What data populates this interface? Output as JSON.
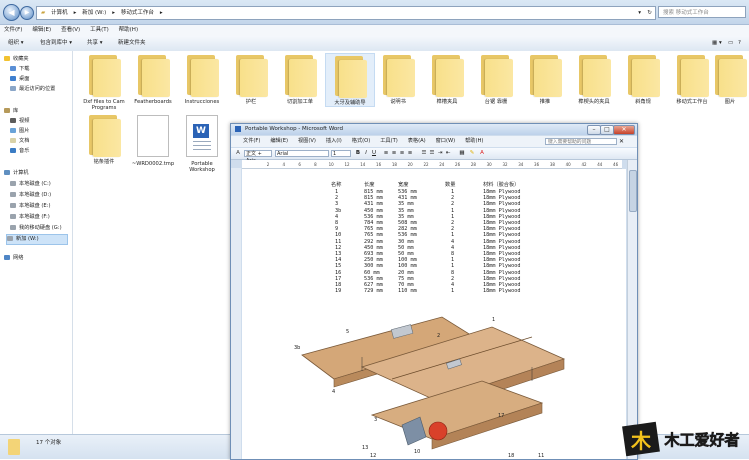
{
  "address": {
    "crumbs": [
      "计算机",
      "新加 (W:)",
      "移动式工作台"
    ],
    "search_placeholder": "搜索 移动式工作台"
  },
  "menu": [
    "文件(F)",
    "编辑(E)",
    "查看(V)",
    "工具(T)",
    "帮助(H)"
  ],
  "toolbar": {
    "organize": "组织 ▾",
    "include": "包含到库中 ▾",
    "share": "共享 ▾",
    "new_folder": "新建文件夹"
  },
  "nav": {
    "favorites": "收藏夹",
    "fav_items": [
      "下载",
      "桌面",
      "最近访问的位置"
    ],
    "libraries": "库",
    "lib_items": [
      "视频",
      "图片",
      "文档",
      "音乐"
    ],
    "computer": "计算机",
    "drives": [
      "本地磁盘 (C:)",
      "本地磁盘 (D:)",
      "本地磁盘 (E:)",
      "本地磁盘 (F:)",
      "我的移动硬盘 (G:)",
      "新加 (W:)"
    ],
    "network": "网络"
  },
  "items": [
    {
      "label": "Dxf files to Cam Programs",
      "kind": "folder"
    },
    {
      "label": "Featherboards",
      "kind": "folder"
    },
    {
      "label": "Instrucciones",
      "kind": "folder"
    },
    {
      "label": "护栏",
      "kind": "folder"
    },
    {
      "label": "切割加工单",
      "kind": "folder"
    },
    {
      "label": "大牙及辅助导",
      "kind": "folder"
    },
    {
      "label": "说明书",
      "kind": "folder"
    },
    {
      "label": "榫槽夹具",
      "kind": "folder"
    },
    {
      "label": "台锯 靠栅",
      "kind": "folder"
    },
    {
      "label": "推推",
      "kind": "folder"
    },
    {
      "label": "榫楔头的夹具",
      "kind": "folder"
    },
    {
      "label": "斜角规",
      "kind": "folder"
    },
    {
      "label": "移动式工作台",
      "kind": "folder"
    },
    {
      "label": "图片",
      "kind": "folder"
    },
    {
      "label": "铭条插件",
      "kind": "folder"
    },
    {
      "label": "~WRD0002.tmp",
      "kind": "file"
    },
    {
      "label": "Portable Workshop",
      "kind": "doc"
    }
  ],
  "status": {
    "count": "17 个对象"
  },
  "word": {
    "title": "Portable Workshop - Microsoft Word",
    "menu": [
      "文件(F)",
      "编辑(E)",
      "视图(V)",
      "插入(I)",
      "格式(O)",
      "工具(T)",
      "表格(A)",
      "窗口(W)",
      "帮助(H)"
    ],
    "help_box": "键入需要帮助的问题",
    "style": "正文 + Aria",
    "font": "Arial",
    "size": "1",
    "bold": "B",
    "italic": "I",
    "underline": "U",
    "ruler_marks": [
      "2",
      "4",
      "6",
      "8",
      "10",
      "12",
      "14",
      "16",
      "18",
      "20",
      "22",
      "24",
      "26",
      "28",
      "30",
      "32",
      "34",
      "36",
      "38",
      "40",
      "42",
      "44",
      "46"
    ],
    "table_headers": [
      "名称",
      "长度",
      "宽度",
      "数量",
      "材料（胶合板）"
    ],
    "table_rows": [
      [
        "1",
        "815 mm",
        "536 mm",
        "1",
        "18mm Plywood"
      ],
      [
        "2",
        "815 mm",
        "431 mm",
        "2",
        "18mm Plywood"
      ],
      [
        "3",
        "431 mm",
        "35 mm",
        "2",
        "18mm Plywood"
      ],
      [
        "3b",
        "450 mm",
        "35 mm",
        "1",
        "18mm Plywood"
      ],
      [
        "4",
        "536 mm",
        "35 mm",
        "1",
        "18mm Plywood"
      ],
      [
        "8",
        "784 mm",
        "508 mm",
        "2",
        "18mm Plywood"
      ],
      [
        "9",
        "765 mm",
        "282 mm",
        "2",
        "18mm Plywood"
      ],
      [
        "10",
        "765 mm",
        "536 mm",
        "1",
        "18mm Plywood"
      ],
      [
        "11",
        "292 mm",
        "30 mm",
        "4",
        "18mm Plywood"
      ],
      [
        "12",
        "450 mm",
        "50 mm",
        "4",
        "18mm Plywood"
      ],
      [
        "13",
        "693 mm",
        "50 mm",
        "8",
        "18mm Plywood"
      ],
      [
        "14",
        "250 mm",
        "100 mm",
        "1",
        "18mm Plywood"
      ],
      [
        "15",
        "300 mm",
        "100 mm",
        "1",
        "18mm Plywood"
      ],
      [
        "16",
        "60 mm",
        "20 mm",
        "8",
        "18mm Plywood"
      ],
      [
        "17",
        "536 mm",
        "75 mm",
        "2",
        "18mm Plywood"
      ],
      [
        "18",
        "627 mm",
        "70 mm",
        "4",
        "18mm Plywood"
      ],
      [
        "19",
        "729 mm",
        "110 mm",
        "1",
        "18mm Plywood"
      ]
    ],
    "callouts": [
      "3b",
      "5",
      "2",
      "1",
      "4",
      "3",
      "17",
      "13",
      "10",
      "12",
      "18",
      "11"
    ]
  },
  "logo": "木工爱好者",
  "colors": {
    "accent": "#1f5fbf",
    "folder": "#f5d778",
    "logo_red": "#e0281e"
  }
}
